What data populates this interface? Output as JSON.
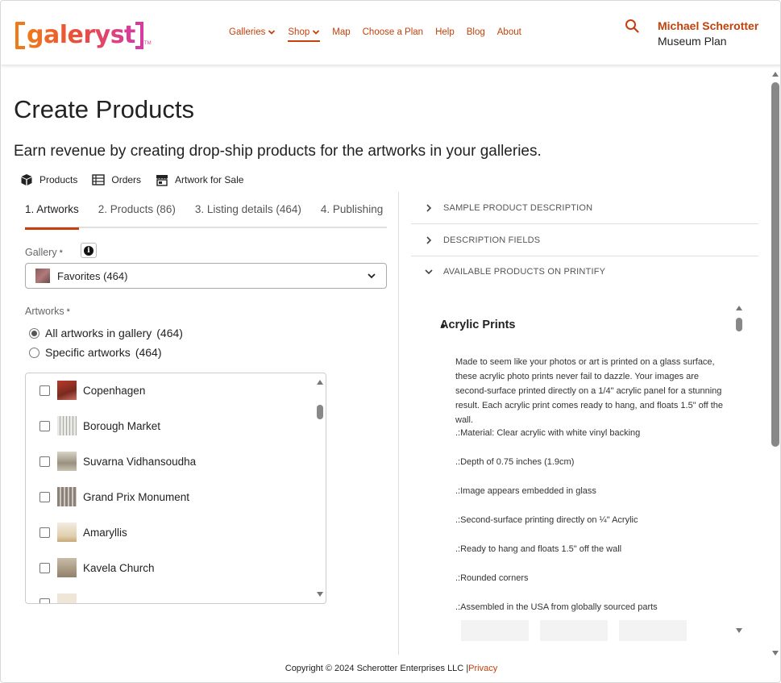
{
  "brand": {
    "logo_text": "galeryst",
    "tm": "TM",
    "accent": "#c2410c"
  },
  "nav": {
    "items": [
      {
        "label": "Galleries",
        "has_menu": true,
        "active": false
      },
      {
        "label": "Shop",
        "has_menu": true,
        "active": true
      },
      {
        "label": "Map",
        "has_menu": false,
        "active": false
      },
      {
        "label": "Choose a Plan",
        "has_menu": false,
        "active": false
      },
      {
        "label": "Help",
        "has_menu": false,
        "active": false
      },
      {
        "label": "Blog",
        "has_menu": false,
        "active": false
      },
      {
        "label": "About",
        "has_menu": false,
        "active": false
      }
    ]
  },
  "user": {
    "name": "Michael Scherotter",
    "plan": "Museum Plan"
  },
  "page": {
    "title": "Create Products",
    "subtitle": "Earn revenue by creating drop-ship products for the artworks in your galleries."
  },
  "subnav": [
    {
      "label": "Products",
      "icon": "box-icon"
    },
    {
      "label": "Orders",
      "icon": "list-icon"
    },
    {
      "label": "Artwork for Sale",
      "icon": "store-icon"
    }
  ],
  "tabs": [
    {
      "label": "1. Artworks",
      "active": true
    },
    {
      "label": "2. Products (86)",
      "active": false
    },
    {
      "label": "3. Listing details (464)",
      "active": false
    },
    {
      "label": "4. Publishing",
      "active": false
    }
  ],
  "gallery": {
    "label": "Gallery",
    "required": "*",
    "info": "i",
    "selected": "Favorites (464)"
  },
  "artworks": {
    "label": "Artworks",
    "required": "*",
    "options": [
      {
        "label": "All artworks in gallery",
        "count": "(464)",
        "selected": true
      },
      {
        "label": "Specific artworks",
        "count": "(464)",
        "selected": false
      }
    ],
    "items": [
      "Copenhagen",
      "Borough Market",
      "Suvarna Vidhansoudha",
      "Grand Prix Monument",
      "Amaryllis",
      "Kavela Church"
    ]
  },
  "accordion": [
    {
      "label": "SAMPLE PRODUCT DESCRIPTION",
      "expanded": false
    },
    {
      "label": "DESCRIPTION FIELDS",
      "expanded": false
    },
    {
      "label": "AVAILABLE PRODUCTS ON PRINTIFY",
      "expanded": true
    }
  ],
  "product": {
    "title": "Acrylic Prints",
    "description": "Made to seem like your photos or art is printed on a glass surface, these acrylic photo prints never fail to dazzle. Your images are second-surface printed directly on a 1/4\" acrylic panel for a stunning result. Each acrylic print comes ready to hang, and floats 1.5\" off the wall.",
    "features": [
      ".:Material: Clear acrylic with white vinyl backing",
      ".:Depth of 0.75 inches (1.9cm)",
      ".:Image appears embedded in glass",
      ".:Second-surface printing directly on ¼\" Acrylic",
      ".:Ready to hang and floats 1.5\" off the wall",
      ".:Rounded corners",
      ".:Assembled in the USA from globally sourced parts"
    ]
  },
  "footer": {
    "copyright": "Copyright © 2024 Scherotter Enterprises LLC",
    "separator": "|",
    "privacy": "Privacy"
  }
}
